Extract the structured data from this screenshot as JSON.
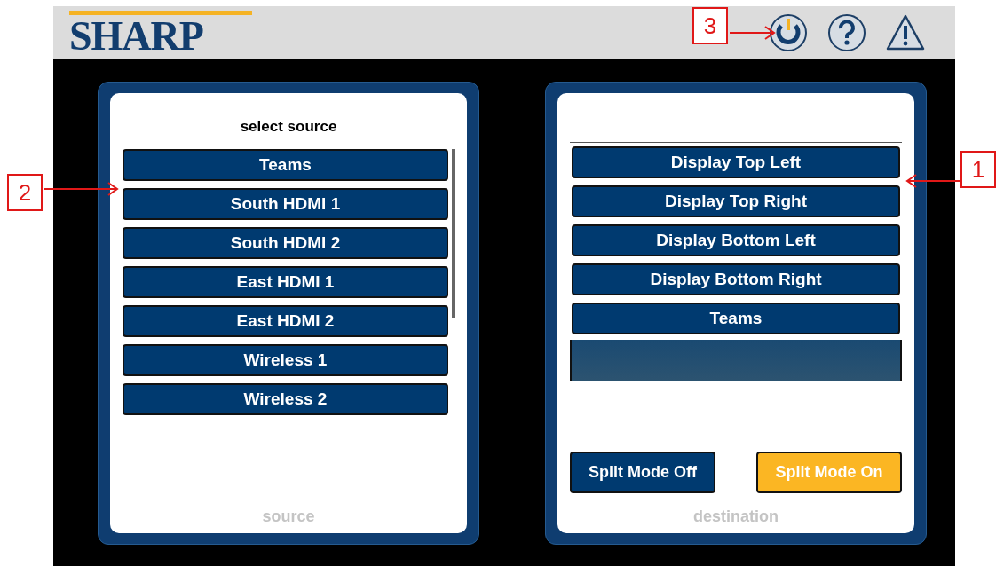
{
  "header": {
    "logo": "SHARP"
  },
  "source_panel": {
    "title": "select source",
    "footer": "source",
    "items": [
      {
        "label": "Teams",
        "selected": false
      },
      {
        "label": "South HDMI 1",
        "selected": false
      },
      {
        "label": "South HDMI 2",
        "selected": false
      },
      {
        "label": "East HDMI 1",
        "selected": false
      },
      {
        "label": "East HDMI 2",
        "selected": false
      },
      {
        "label": "Wireless 1",
        "selected": false
      },
      {
        "label": "Wireless 2",
        "selected": false
      }
    ]
  },
  "destination_panel": {
    "footer": "destination",
    "items": [
      {
        "label": "Display Top Left",
        "selected": false
      },
      {
        "label": "Display Top Right",
        "selected": false
      },
      {
        "label": "Display Bottom Left",
        "selected": false
      },
      {
        "label": "Display Bottom Right",
        "selected": false
      },
      {
        "label": "Teams",
        "selected": false
      }
    ],
    "split_mode": [
      {
        "label": "Split Mode Off",
        "selected": false
      },
      {
        "label": "Split Mode On",
        "selected": true
      }
    ]
  },
  "callouts": [
    {
      "label": "1"
    },
    {
      "label": "2"
    },
    {
      "label": "3"
    }
  ]
}
